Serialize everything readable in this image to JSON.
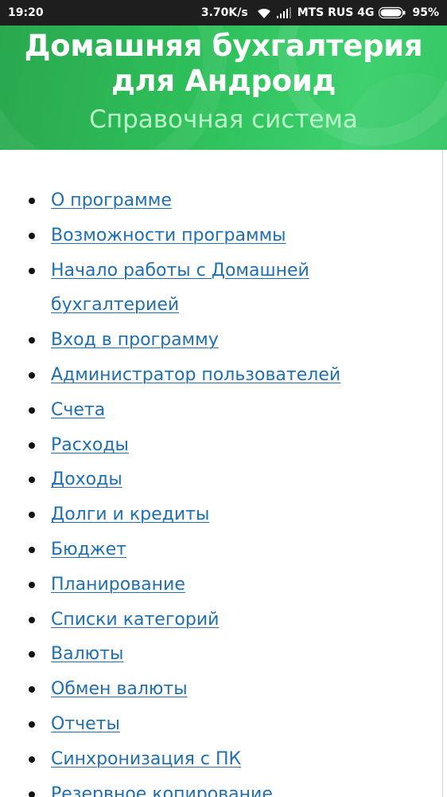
{
  "status_bar": {
    "time": "19:20",
    "speed": "3.70K/s",
    "carrier": "MTS RUS 4G",
    "battery": "95%",
    "icons": [
      "wifi-icon",
      "signal-icon",
      "battery-icon"
    ]
  },
  "header": {
    "title": "Домашняя бухгалтерия для Андроид",
    "subtitle": "Справочная система",
    "background_color": "#2ec05a",
    "subtitle_color": "#b9f5c9"
  },
  "toc": {
    "link_color": "#1f6fb2",
    "items": [
      {
        "label": "О программе"
      },
      {
        "label": "Возможности программы"
      },
      {
        "label": "Начало работы с Домашней бухгалтерией"
      },
      {
        "label": "Вход в программу"
      },
      {
        "label": "Администратор пользователей"
      },
      {
        "label": "Счета"
      },
      {
        "label": "Расходы"
      },
      {
        "label": "Доходы"
      },
      {
        "label": "Долги и кредиты"
      },
      {
        "label": "Бюджет"
      },
      {
        "label": "Планирование"
      },
      {
        "label": "Списки категорий"
      },
      {
        "label": "Валюты"
      },
      {
        "label": "Обмен валюты"
      },
      {
        "label": "Отчеты"
      },
      {
        "label": "Синхронизация с ПК"
      },
      {
        "label": "Резервное копирование"
      }
    ]
  }
}
